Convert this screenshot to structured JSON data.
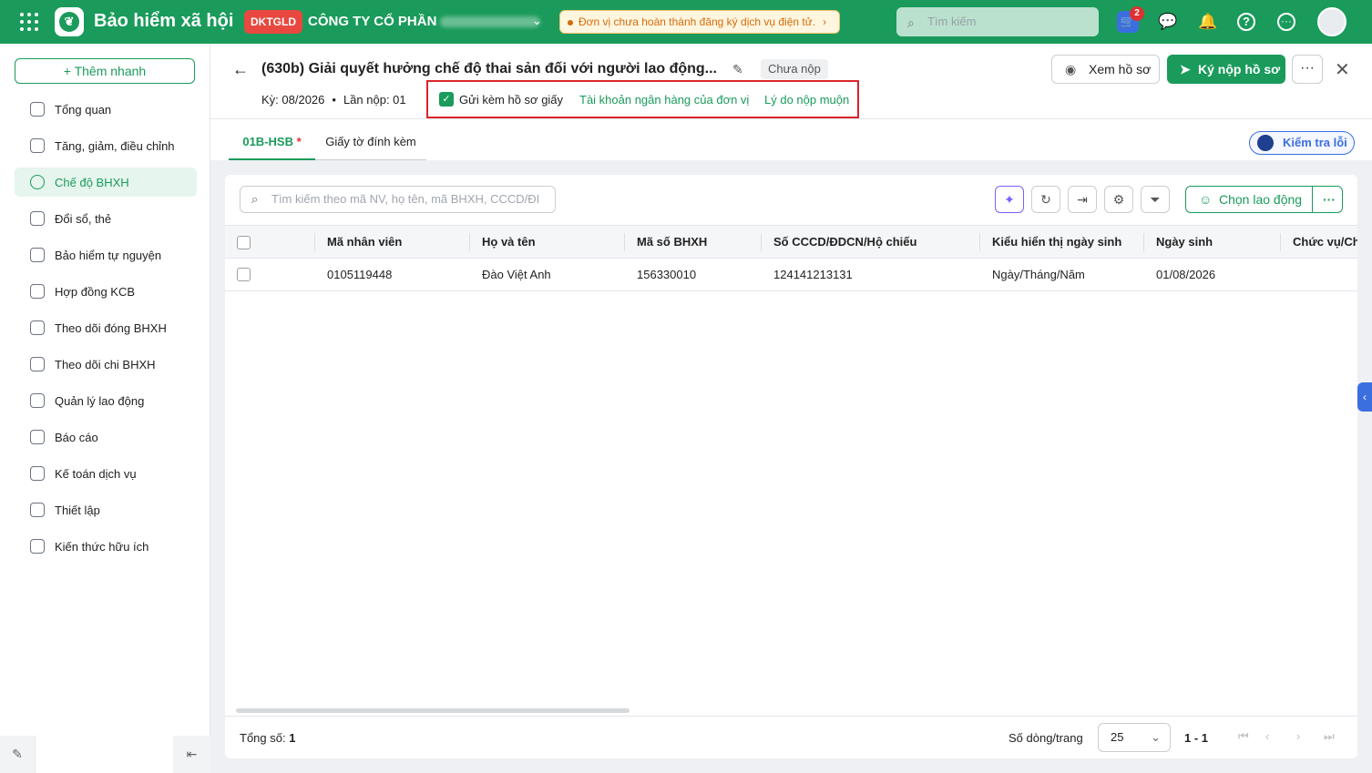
{
  "topbar": {
    "app_title": "Bảo hiểm xã hội",
    "tag": "DKTGLD",
    "company": "CÔNG TY CỔ PHẦN",
    "notice": "Đơn vị chưa hoàn thành đăng ký dịch vụ điện tử.",
    "search_placeholder": "Tìm kiếm",
    "cart_badge": "2",
    "brand_color": "#1a9b5b"
  },
  "sidebar": {
    "quick_add": "Thêm nhanh",
    "items": [
      {
        "label": "Tổng quan",
        "icon": "home-icon"
      },
      {
        "label": "Tăng, giảm, điều chỉnh",
        "icon": "user-adjust-icon"
      },
      {
        "label": "Chế độ BHXH",
        "icon": "heart-shield-icon",
        "active": true
      },
      {
        "label": "Đổi sổ, thẻ",
        "icon": "card-icon"
      },
      {
        "label": "Bảo hiểm tự nguyện",
        "icon": "shield-icon"
      },
      {
        "label": "Hợp đồng KCB",
        "icon": "contract-icon"
      },
      {
        "label": "Theo dõi đóng BHXH",
        "icon": "calendar-icon"
      },
      {
        "label": "Theo dõi chi BHXH",
        "icon": "document-icon"
      },
      {
        "label": "Quản lý lao động",
        "icon": "users-icon"
      },
      {
        "label": "Báo cáo",
        "icon": "report-icon"
      },
      {
        "label": "Kế toán dịch vụ",
        "icon": "accounting-icon"
      },
      {
        "label": "Thiết lập",
        "icon": "gear-icon"
      },
      {
        "label": "Kiến thức hữu ích",
        "icon": "lightbulb-icon"
      }
    ]
  },
  "header": {
    "title": "(630b) Giải quyết hưởng chế độ thai sản đối với người lao động...",
    "status": "Chưa nộp",
    "period": "Kỳ: 08/2026",
    "submission": "Lần nộp: 01",
    "attach_paper": "Gửi kèm hồ sơ giấy",
    "bank_link": "Tài khoản ngân hàng của đơn vị",
    "late_link": "Lý do nộp muộn",
    "view_button": "Xem hồ sơ",
    "sign_button": "Ký nộp hồ sơ"
  },
  "tabs": {
    "tab1": "01B-HSB",
    "tab1_required": "*",
    "tab2": "Giấy tờ đính kèm",
    "check_errors": "Kiểm tra lỗi"
  },
  "table": {
    "search_placeholder": "Tìm kiếm theo mã NV, họ tên, mã BHXH, CCCD/ĐI",
    "choose_button": "Chọn lao động",
    "columns": [
      "Mã nhân viên",
      "Họ và tên",
      "Mã số BHXH",
      "Số CCCD/ĐDCN/Hộ chiếu",
      "Kiểu hiển thị ngày sinh",
      "Ngày sinh",
      "Chức vụ/Ch"
    ],
    "rows": [
      [
        "0105119448",
        "Đào Việt Anh",
        "156330010",
        "124141213131",
        "Ngày/Tháng/Năm",
        "01/08/2026",
        ""
      ]
    ]
  },
  "footer": {
    "total_label": "Tổng số:",
    "total_value": "1",
    "rows_per_page_label": "Số dòng/trang",
    "rows_per_page": "25",
    "range": "1 - 1"
  }
}
